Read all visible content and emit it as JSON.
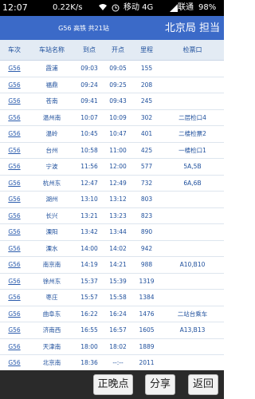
{
  "status_bar": {
    "time": "12:07",
    "speed": "0.22K/s",
    "operator1": "移动 4G",
    "operator2": "联通",
    "battery": "98%"
  },
  "header": {
    "title": "G56 高铁 共21站",
    "bureau": "北京局 担当"
  },
  "table": {
    "headers": [
      "车次",
      "车站名称",
      "到点",
      "开点",
      "里程",
      "检票口"
    ],
    "rows": [
      {
        "train": "G56",
        "station": "霞浦",
        "arrive": "09:03",
        "depart": "09:05",
        "km": "155",
        "gate": ""
      },
      {
        "train": "G56",
        "station": "福鼎",
        "arrive": "09:24",
        "depart": "09:25",
        "km": "208",
        "gate": ""
      },
      {
        "train": "G56",
        "station": "苍南",
        "arrive": "09:41",
        "depart": "09:43",
        "km": "245",
        "gate": ""
      },
      {
        "train": "G56",
        "station": "温州南",
        "arrive": "10:07",
        "depart": "10:09",
        "km": "302",
        "gate": "二层检口4"
      },
      {
        "train": "G56",
        "station": "温岭",
        "arrive": "10:45",
        "depart": "10:47",
        "km": "401",
        "gate": "二楼检票2"
      },
      {
        "train": "G56",
        "station": "台州",
        "arrive": "10:58",
        "depart": "11:00",
        "km": "425",
        "gate": "一楼检口1"
      },
      {
        "train": "G56",
        "station": "宁波",
        "arrive": "11:56",
        "depart": "12:00",
        "km": "577",
        "gate": "5A,5B"
      },
      {
        "train": "G56",
        "station": "杭州东",
        "arrive": "12:47",
        "depart": "12:49",
        "km": "732",
        "gate": "6A,6B"
      },
      {
        "train": "G56",
        "station": "湖州",
        "arrive": "13:10",
        "depart": "13:12",
        "km": "803",
        "gate": ""
      },
      {
        "train": "G56",
        "station": "长兴",
        "arrive": "13:21",
        "depart": "13:23",
        "km": "823",
        "gate": ""
      },
      {
        "train": "G56",
        "station": "溧阳",
        "arrive": "13:42",
        "depart": "13:44",
        "km": "890",
        "gate": ""
      },
      {
        "train": "G56",
        "station": "溧水",
        "arrive": "14:00",
        "depart": "14:02",
        "km": "942",
        "gate": ""
      },
      {
        "train": "G56",
        "station": "南京南",
        "arrive": "14:19",
        "depart": "14:21",
        "km": "988",
        "gate": "A10,B10"
      },
      {
        "train": "G56",
        "station": "徐州东",
        "arrive": "15:37",
        "depart": "15:39",
        "km": "1319",
        "gate": ""
      },
      {
        "train": "G56",
        "station": "枣庄",
        "arrive": "15:57",
        "depart": "15:58",
        "km": "1384",
        "gate": ""
      },
      {
        "train": "G56",
        "station": "曲阜东",
        "arrive": "16:22",
        "depart": "16:24",
        "km": "1476",
        "gate": "二站台乘车"
      },
      {
        "train": "G56",
        "station": "济南西",
        "arrive": "16:55",
        "depart": "16:57",
        "km": "1605",
        "gate": "A13,B13"
      },
      {
        "train": "G56",
        "station": "天津南",
        "arrive": "18:00",
        "depart": "18:02",
        "km": "1889",
        "gate": ""
      },
      {
        "train": "G56",
        "station": "北京南",
        "arrive": "18:36",
        "depart": "--:--",
        "km": "2011",
        "gate": ""
      }
    ]
  },
  "buttons": {
    "late": "正晚点",
    "share": "分享",
    "back": "返回"
  }
}
